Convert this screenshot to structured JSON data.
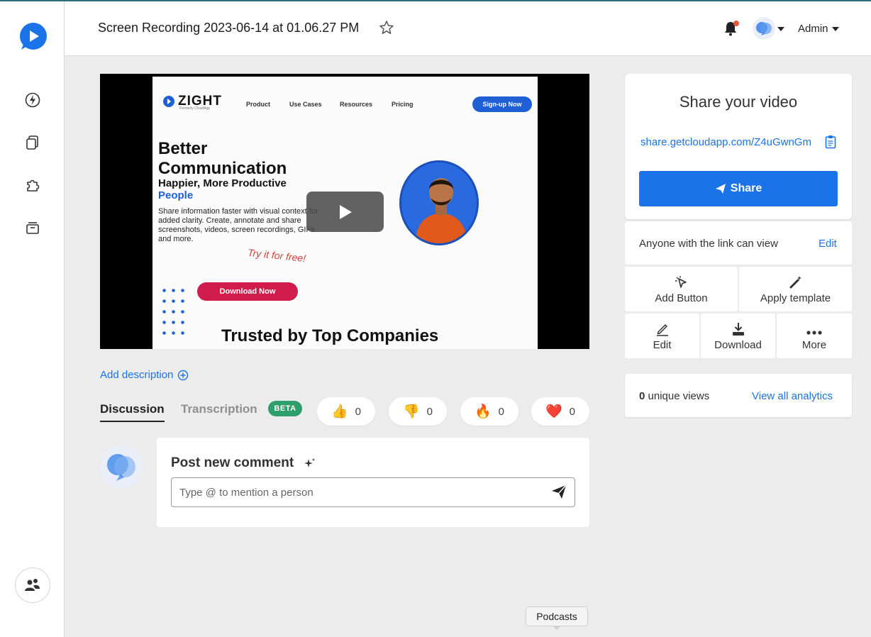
{
  "app": {
    "sidebar": {
      "logo_icon": "zight-logo-icon",
      "items": [
        {
          "icon": "lightning-icon"
        },
        {
          "icon": "copy-icon"
        },
        {
          "icon": "puzzle-icon"
        },
        {
          "icon": "archive-icon"
        }
      ],
      "team_icon": "team-icon"
    },
    "header": {
      "title": "Screen Recording 2023-06-14 at 01.06.27 PM",
      "user_label": "Admin"
    }
  },
  "video": {
    "preview": {
      "logo_text": "ZIGHT",
      "logo_sub": "Formerly CloudApp",
      "nav": [
        "Product",
        "Use Cases",
        "Resources",
        "Pricing"
      ],
      "cta": "Sign-up Now",
      "headline_1": "Better",
      "headline_2": "Communication",
      "headline_3": "Happier, More Productive",
      "headline_4": "People",
      "body": "Share information faster with visual context for added clarity. Create, annotate and share screenshots, videos, screen recordings, GIFs and more.",
      "try_free": "Try it for free!",
      "download": "Download Now",
      "trusted": "Trusted by Top Companies"
    }
  },
  "below_video": {
    "add_description": "Add description",
    "tabs": {
      "discussion": "Discussion",
      "transcription": "Transcription",
      "beta": "BETA"
    },
    "reactions": [
      {
        "emoji": "👍",
        "count": "0"
      },
      {
        "emoji": "👎",
        "count": "0"
      },
      {
        "emoji": "🔥",
        "count": "0"
      },
      {
        "emoji": "❤️",
        "count": "0"
      }
    ],
    "comment": {
      "title": "Post new comment",
      "placeholder": "Type @ to mention a person"
    }
  },
  "share_panel": {
    "title": "Share your video",
    "link": "share.getcloudapp.com/Z4uGwnGm",
    "share_button": "Share",
    "permission_text": "Anyone with the link can view",
    "permission_edit": "Edit",
    "actions": [
      {
        "label": "Add Button",
        "icon": "cursor-click-icon"
      },
      {
        "label": "Apply template",
        "icon": "magic-wand-icon"
      },
      {
        "label": "Edit",
        "icon": "pen-icon"
      },
      {
        "label": "Download",
        "icon": "download-icon"
      },
      {
        "label": "More",
        "icon": "more-dots-icon"
      }
    ],
    "views_count": "0",
    "views_label": "unique views",
    "analytics_link": "View all analytics"
  },
  "tooltip": "Podcasts",
  "colors": {
    "accent": "#1a73e8",
    "beta": "#2e9e6b",
    "sidebar_bg": "#ffffff",
    "page_bg": "#ececec"
  }
}
